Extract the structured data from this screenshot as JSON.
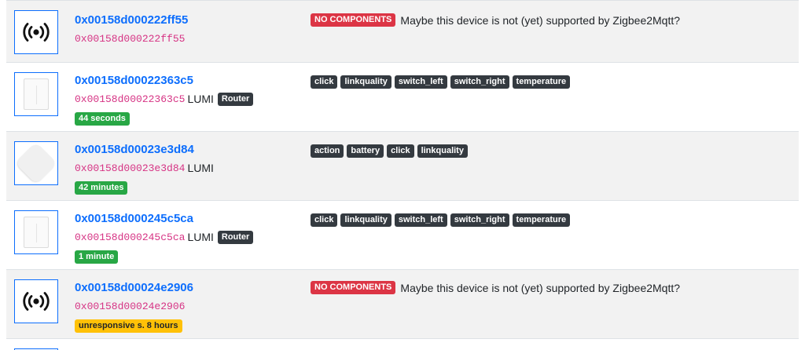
{
  "no_components_label": "NO COMPONENTS",
  "unsupported_message": "Maybe this device is not (yet) supported by Zigbee2Mqtt?",
  "devices": [
    {
      "friendly_name": "0x00158d000222ff55",
      "ieee": "0x00158d000222ff55",
      "vendor": "",
      "type": "",
      "last_seen": "",
      "image": "broadcast-icon",
      "features": [],
      "supported": false
    },
    {
      "friendly_name": "0x00158d00022363c5",
      "ieee": "0x00158d00022363c5",
      "vendor": "LUMI",
      "type": "Router",
      "last_seen": "44 seconds",
      "last_seen_status": "success",
      "image": "wall-switch",
      "features": [
        "click",
        "linkquality",
        "switch_left",
        "switch_right",
        "temperature"
      ],
      "supported": true
    },
    {
      "friendly_name": "0x00158d00023e3d84",
      "ieee": "0x00158d00023e3d84",
      "vendor": "LUMI",
      "type": "",
      "last_seen": "42 minutes",
      "last_seen_status": "success",
      "image": "wireless-button",
      "features": [
        "action",
        "battery",
        "click",
        "linkquality"
      ],
      "supported": true
    },
    {
      "friendly_name": "0x00158d000245c5ca",
      "ieee": "0x00158d000245c5ca",
      "vendor": "LUMI",
      "type": "Router",
      "last_seen": "1 minute",
      "last_seen_status": "success",
      "image": "wall-switch",
      "features": [
        "click",
        "linkquality",
        "switch_left",
        "switch_right",
        "temperature"
      ],
      "supported": true
    },
    {
      "friendly_name": "0x00158d00024e2906",
      "ieee": "0x00158d00024e2906",
      "vendor": "",
      "type": "",
      "last_seen": "unresponsive s. 8 hours",
      "last_seen_status": "warning",
      "image": "broadcast-icon",
      "features": [],
      "supported": false
    }
  ],
  "colors": {
    "link": "#0d6efd",
    "ieee": "#d63384",
    "row_stripe": "#f2f2f2",
    "badge_dark": "#343a40",
    "badge_success": "#28a745",
    "badge_warning": "#ffc107",
    "badge_danger": "#dc3545"
  }
}
